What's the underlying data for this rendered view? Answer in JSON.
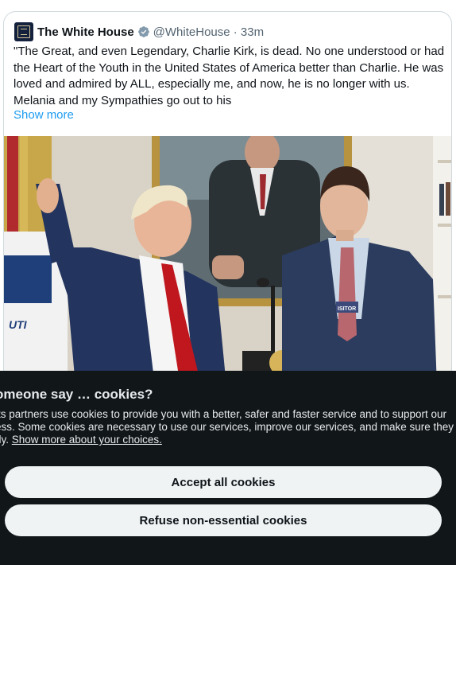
{
  "tweet": {
    "display_name": "The White House",
    "handle_time": "@WhiteHouse · 33m",
    "text": "\"The Great, and even Legendary, Charlie Kirk, is dead. No one understood or had the Heart of the Youth in the United States of America better than Charlie. He was loved and admired by ALL, especially me, and now, he is no longer with us. Melania and my Sympathies go out to his",
    "show_more": "Show more",
    "verified_color": "#829aab",
    "link_color": "#1d9bf0"
  },
  "media": {
    "badge_text": "ISITOR",
    "flag_text": "UTI"
  },
  "cookies": {
    "title": "omeone say … cookies?",
    "lines": [
      "its partners use cookies to provide you with a better, safer and faster service and to support our",
      "ess. Some cookies are necessary to use our services, improve our services, and make sure they wo",
      "rly."
    ],
    "link": "Show more about your choices.",
    "accept_label": "Accept all cookies",
    "refuse_label": "Refuse non-essential cookies",
    "background": "#111619",
    "button_background": "#eff3f4"
  }
}
